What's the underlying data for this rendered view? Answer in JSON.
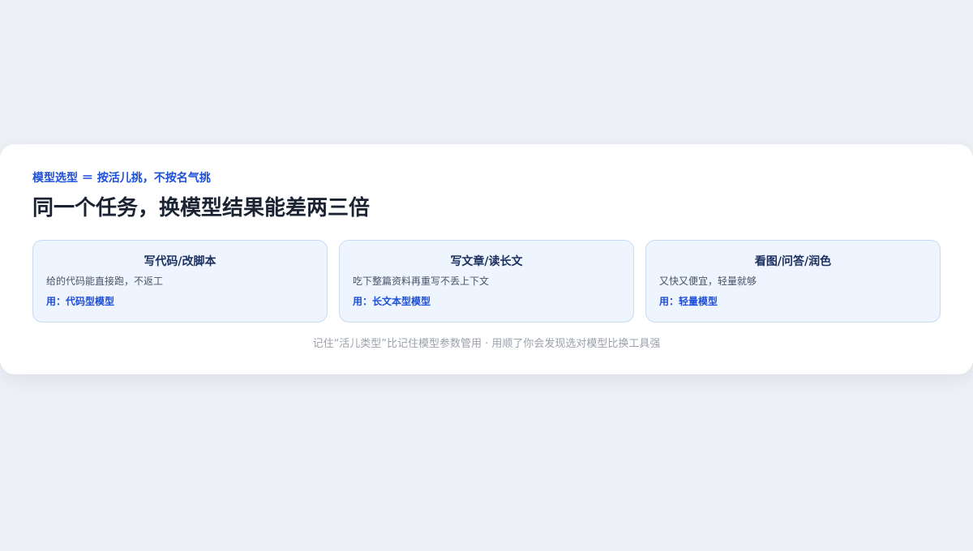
{
  "header": {
    "kicker": "模型选型 ＝ 按活儿挑，不按名气挑",
    "title": "同一个任务，换模型结果能差两三倍"
  },
  "cards": [
    {
      "title": "写代码/改脚本",
      "desc": "给的代码能直接跑，不返工",
      "use": "用：代码型模型"
    },
    {
      "title": "写文章/读长文",
      "desc": "吃下整篇资料再重写不丢上下文",
      "use": "用：长文本型模型"
    },
    {
      "title": "看图/问答/润色",
      "desc": "又快又便宜，轻量就够",
      "use": "用：轻量模型"
    }
  ],
  "footer": {
    "note": "记住“活儿类型”比记住模型参数管用 · 用顺了你会发现选对模型比换工具强"
  },
  "colors": {
    "background": "#edf0f5",
    "accent": "#1d4fd8",
    "tile_bg": "#eef5ff",
    "tile_border": "#c9dbf2"
  }
}
